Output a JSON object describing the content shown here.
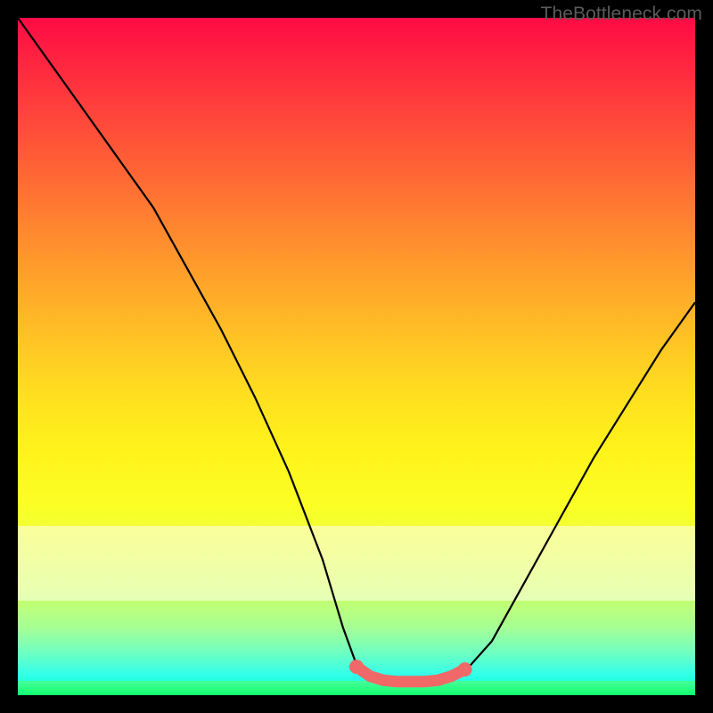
{
  "watermark": "TheBottleneck.com",
  "chart_data": {
    "type": "line",
    "title": "",
    "xlabel": "",
    "ylabel": "",
    "xlim": [
      0,
      100
    ],
    "ylim": [
      0,
      100
    ],
    "grid": false,
    "series": [
      {
        "name": "curve",
        "x": [
          0,
          5,
          10,
          15,
          20,
          25,
          30,
          35,
          40,
          45,
          48,
          50,
          53,
          56,
          60,
          63,
          66,
          70,
          75,
          80,
          85,
          90,
          95,
          100
        ],
        "y": [
          100,
          93,
          86,
          79,
          72,
          63,
          54,
          44,
          33,
          20,
          10,
          4.5,
          2.2,
          2,
          2,
          2.2,
          3.5,
          8,
          17,
          26,
          35,
          43,
          51,
          58
        ]
      }
    ],
    "highlight": {
      "name": "flat-region",
      "color": "#f06868",
      "x": [
        50,
        52,
        54,
        56,
        58,
        60,
        62,
        64,
        66
      ],
      "y": [
        4.2,
        2.8,
        2.2,
        2,
        2,
        2,
        2.2,
        2.8,
        3.8
      ]
    },
    "bands": [
      {
        "name": "pale",
        "y0": 14,
        "y1": 25,
        "color": "rgba(255,255,240,0.55)"
      },
      {
        "name": "green",
        "y0": 0,
        "y1": 2.1,
        "color": "#11ff6f"
      }
    ]
  }
}
